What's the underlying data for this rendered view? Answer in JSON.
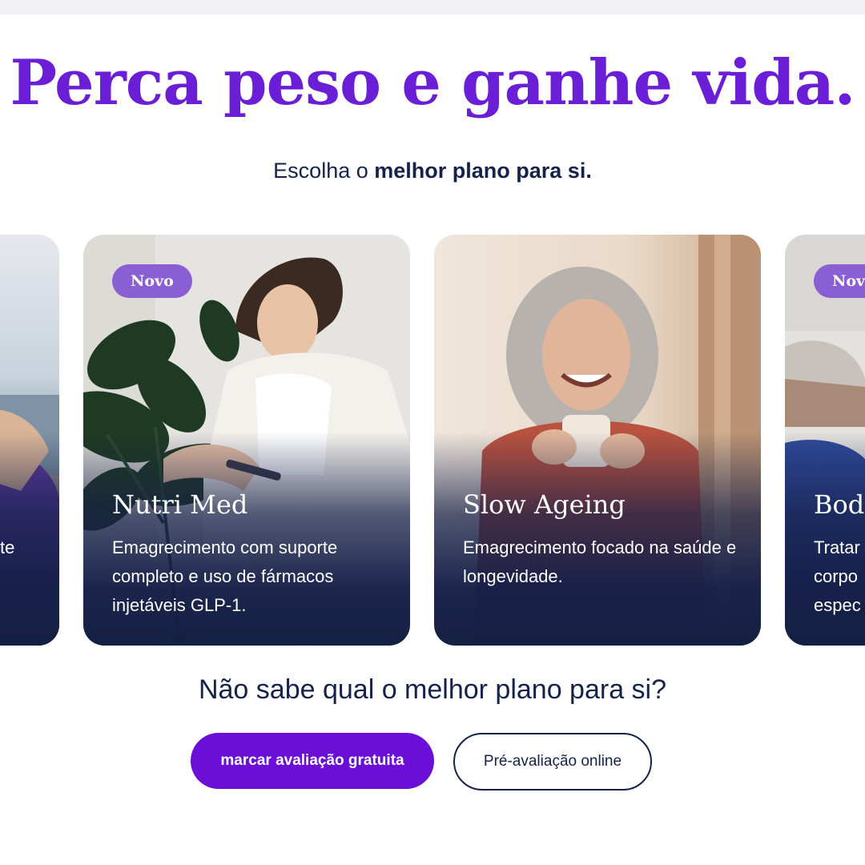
{
  "hero": {
    "headline": "Perca peso e ganhe vida.",
    "subline_prefix": "Escolha o ",
    "subline_bold": "melhor plano para si."
  },
  "cards": [
    {
      "id": "left",
      "title": "",
      "badge": "",
      "description_fragment": "te"
    },
    {
      "id": "nutri-med",
      "badge": "Novo",
      "title": "Nutri Med",
      "description": "Emagrecimento com suporte completo e uso de fármacos injetáveis GLP-1."
    },
    {
      "id": "slow-ageing",
      "badge": "",
      "title": "Slow Ageing",
      "description": "Emagrecimento focado na saúde e longevidade."
    },
    {
      "id": "body",
      "badge": "Nov",
      "title": "Bod",
      "description_lines": [
        "Tratar",
        "corpo",
        "espec"
      ]
    }
  ],
  "help": {
    "question": "Não sabe qual o melhor plano para si?",
    "primary_button": "marcar avaliação gratuita",
    "secondary_button": "Pré-avaliação online"
  },
  "colors": {
    "accent": "#6a1fd6",
    "navy": "#15224a",
    "badge": "#8a5fd3",
    "button": "#6b0fd8"
  }
}
